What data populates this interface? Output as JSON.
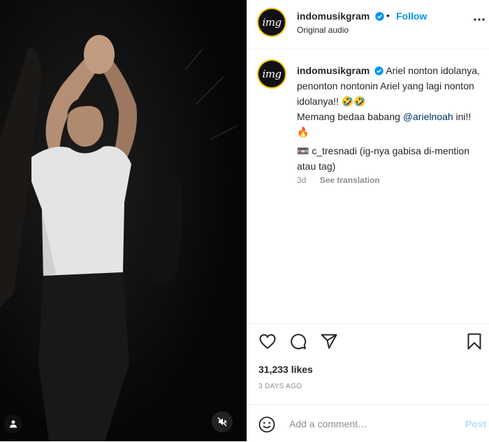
{
  "media": {
    "icons": {
      "user_tag": "person-icon",
      "mute": "speaker-muted-icon"
    }
  },
  "header": {
    "avatar_text": "img",
    "username": "indomusikgram",
    "separator": "•",
    "follow_label": "Follow",
    "subtitle": "Original audio",
    "icons": {
      "verified": "verified-badge-icon",
      "more": "more-options-icon"
    }
  },
  "caption": {
    "username": "indomusikgram",
    "text_1": "Ariel nonton idolanya, penonton nontonin Ariel yang lagi nonton idolanya!! 🤣🤣",
    "text_2": "Memang bedaa babang ",
    "mention": "@arielnoah",
    "text_3": " ini!! 🔥",
    "credit_emoji": "📼",
    "credit": " c_tresnadi (ig-nya gabisa di-mention atau tag)",
    "time": "3d",
    "see_translation": "See translation"
  },
  "actions": {
    "icons": [
      "heart-icon",
      "comment-icon",
      "share-icon",
      "bookmark-icon"
    ]
  },
  "likes": "31,233 likes",
  "posted_ago": "3 DAYS AGO",
  "comment": {
    "placeholder": "Add a comment…",
    "post_label": "Post",
    "emoji_icon": "smiley-icon"
  },
  "colors": {
    "accent": "#0095f6",
    "mention": "#00376b",
    "muted": "#8e8e8e",
    "post_disabled": "#b2dffc"
  }
}
